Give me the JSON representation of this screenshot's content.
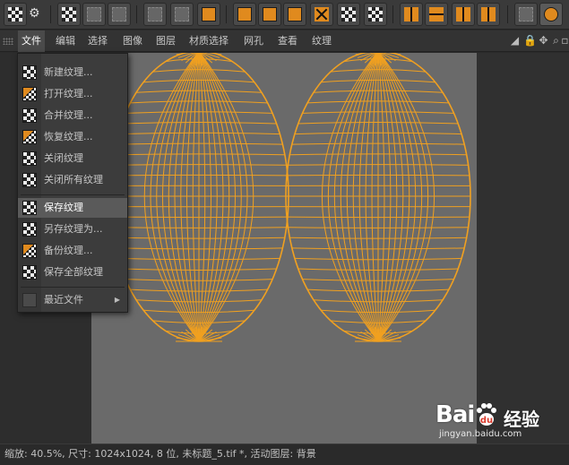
{
  "menubar": {
    "items": [
      "文件",
      "编辑",
      "选择",
      "图像",
      "图层",
      "材质选择",
      "网孔",
      "查看",
      "纹理"
    ],
    "active_index": 0
  },
  "file_menu": {
    "items": [
      {
        "label": "新建纹理...",
        "icon": "new-texture-icon"
      },
      {
        "label": "打开纹理...",
        "icon": "open-texture-icon"
      },
      {
        "label": "合并纹理...",
        "icon": "merge-texture-icon"
      },
      {
        "label": "恢复纹理...",
        "icon": "revert-texture-icon"
      },
      {
        "label": "关闭纹理",
        "icon": "close-texture-icon"
      },
      {
        "label": "关闭所有纹理",
        "icon": "close-all-textures-icon"
      },
      {
        "label": "保存纹理",
        "icon": "save-texture-icon",
        "highlighted": true
      },
      {
        "label": "另存纹理为...",
        "icon": "save-texture-as-icon"
      },
      {
        "label": "备份纹理...",
        "icon": "backup-texture-icon"
      },
      {
        "label": "保存全部纹理",
        "icon": "save-all-textures-icon"
      },
      {
        "label": "最近文件",
        "icon": "recent-files-icon",
        "submenu": true
      }
    ]
  },
  "status": {
    "text": "缩放: 40.5%, 尺寸: 1024x1024, 8 位, 未标题_5.tif *, 活动图层: 背景"
  },
  "watermark": {
    "logo": "Bai",
    "brand": "经验",
    "url": "jingyan.baidu.com"
  },
  "colors": {
    "uv_mesh": "#f0a020",
    "canvas": "#6a6a6a",
    "accent": "#e08a1e"
  }
}
